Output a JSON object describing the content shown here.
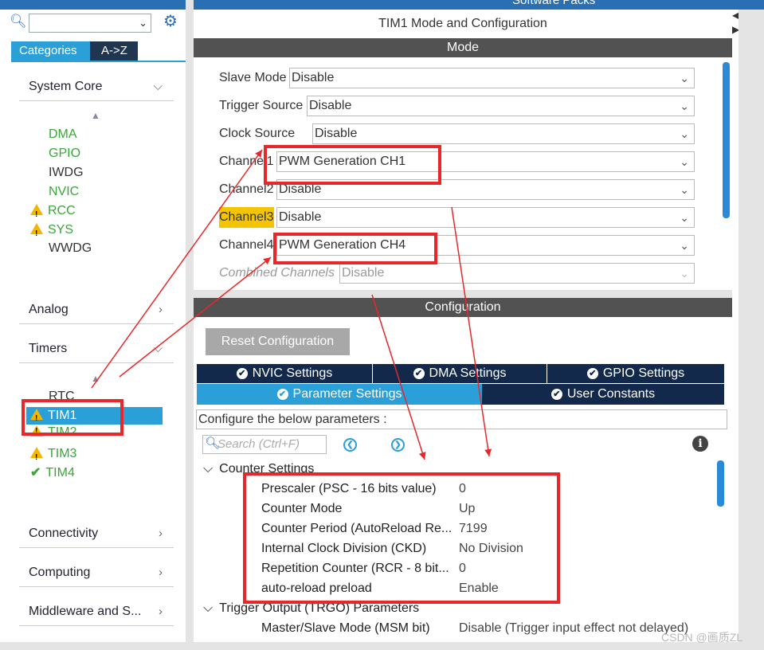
{
  "sidebar": {
    "search_value": "",
    "tabs": {
      "categories": "Categories",
      "az": "A->Z"
    },
    "categories": {
      "system_core": "System Core",
      "analog": "Analog",
      "timers": "Timers",
      "connectivity": "Connectivity",
      "computing": "Computing",
      "middleware": "Middleware and S..."
    },
    "system_core_items": [
      "DMA",
      "GPIO",
      "IWDG",
      "NVIC",
      "RCC",
      "SYS",
      "WWDG"
    ],
    "timers_items": [
      "RTC",
      "TIM1",
      "TIM2",
      "TIM3",
      "TIM4"
    ]
  },
  "main": {
    "header_partial": "Software Packs",
    "title": "TIM1 Mode and Configuration",
    "mode_bar": "Mode",
    "mode": [
      {
        "label": "Slave Mode",
        "value": "Disable"
      },
      {
        "label": "Trigger Source",
        "value": "Disable"
      },
      {
        "label": "Clock Source",
        "value": "Disable"
      },
      {
        "label": "Channel1",
        "value": "PWM Generation CH1"
      },
      {
        "label": "Channel2",
        "value": "Disable"
      },
      {
        "label": "Channel3",
        "value": "Disable"
      },
      {
        "label": "Channel4",
        "value": "PWM Generation CH4"
      },
      {
        "label": "Combined Channels",
        "value": "Disable"
      }
    ],
    "config_bar": "Configuration",
    "reset_button": "Reset Configuration",
    "tabs_row1": [
      "NVIC Settings",
      "DMA Settings",
      "GPIO Settings"
    ],
    "tabs_row2": [
      "Parameter Settings",
      "User Constants"
    ],
    "configure_hint": "Configure the below parameters :",
    "search_placeholder": "Search (Ctrl+F)",
    "counter_group": "Counter Settings",
    "params": [
      {
        "k": "Prescaler (PSC - 16 bits value)",
        "v": "0"
      },
      {
        "k": "Counter Mode",
        "v": "Up"
      },
      {
        "k": "Counter Period (AutoReload Re...",
        "v": "7199"
      },
      {
        "k": "Internal Clock Division (CKD)",
        "v": "No Division"
      },
      {
        "k": "Repetition Counter (RCR - 8 bit...",
        "v": "0"
      },
      {
        "k": "auto-reload preload",
        "v": "Enable"
      }
    ],
    "trgo_group": "Trigger Output (TRGO) Parameters",
    "msm": {
      "k": "Master/Slave Mode (MSM bit)",
      "v": "Disable (Trigger input effect not delayed)"
    }
  },
  "watermark": "CSDN @画质ZL",
  "colors": {
    "accent": "#2a9fd8",
    "dark_tab": "#13294b",
    "annotation_red": "#e8272a",
    "warning": "#f2b600",
    "ok_green": "#3aa53a"
  }
}
